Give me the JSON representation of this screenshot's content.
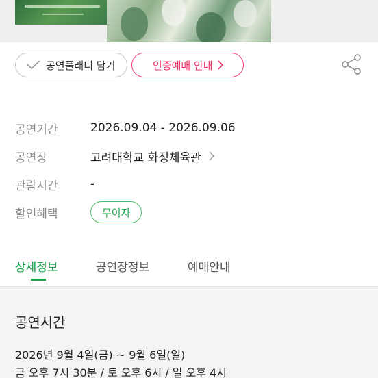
{
  "buttons": {
    "planner_label": "공연플래너 담기",
    "cert_label": "인증예매 안내"
  },
  "info": {
    "period_label": "공연기간",
    "period_value": "2026.09.04 - 2026.09.06",
    "venue_label": "공연장",
    "venue_value": "고려대학교 화정체육관",
    "runtime_label": "관람시간",
    "runtime_value": "-",
    "discount_label": "할인혜택",
    "discount_value": "무이자"
  },
  "tabs": [
    {
      "label": "상세정보",
      "active": true
    },
    {
      "label": "공연장정보",
      "active": false
    },
    {
      "label": "예매안내",
      "active": false
    }
  ],
  "detail": {
    "title": "공연시간",
    "line1": "2026년 9월 4일(금) ~ 9월 6일(일)",
    "line2": "금 오후 7시 30분 / 토 오후 6시 / 일 오후 4시"
  },
  "colors": {
    "accent_pink": "#ef2f63",
    "accent_green": "#16a34a"
  }
}
